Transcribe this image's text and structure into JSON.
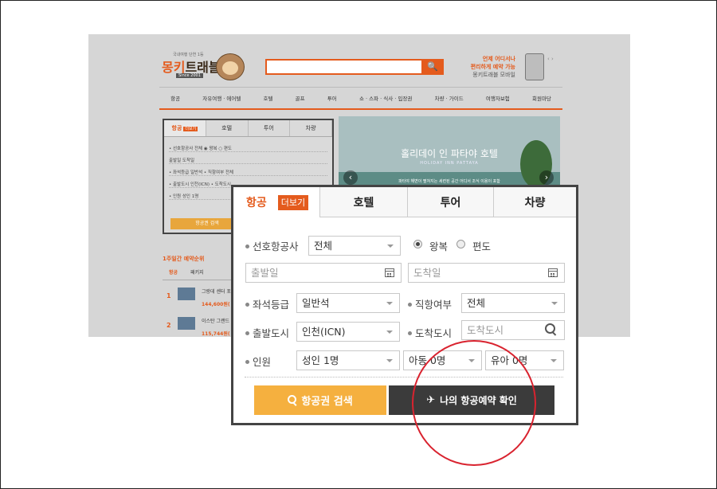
{
  "site": {
    "logo": {
      "tagline": "국내여행 단연 1등",
      "brand_a": "몽키",
      "brand_b": "트래블",
      "since": "Since 2001"
    },
    "promo": {
      "line1": "언제 어디서나",
      "line2": "편리하게 예약 가능",
      "line3": "몽키트래블 모바일"
    },
    "arrows": "‹ ›",
    "search_icon": "🔍",
    "nav": [
      "항공",
      "자유여행 · 에어텔",
      "호텔",
      "골프",
      "투어",
      "쇼 · 스파 · 식사 · 입장권",
      "차량 · 가이드",
      "여행자보험",
      "회원마당"
    ],
    "mini": {
      "tabs": [
        "항공",
        "호텔",
        "투어",
        "차량"
      ],
      "more": "더보기",
      "rows": [
        "• 선호항공사  전체      ◉ 왕복  ○ 편도",
        "출발일            도착일",
        "• 좌석등급  일반석   • 직항여부  전체",
        "• 출발도시  인천(ICN)  • 도착도시",
        "• 인원  성인 1명"
      ],
      "button": "항공권 검색"
    },
    "banner": {
      "title": "홀리데이 인 파타야 호텔",
      "sub": "HOLIDAY INN PATTAYA",
      "cap": "파타야 해변이 펼쳐지는 세련된 공간 어디서 조식 이용이 포함"
    },
    "ranking": {
      "title": "1주일간 예약순위",
      "tabs": [
        "항공",
        "패키지"
      ],
      "items": [
        {
          "num": "1",
          "name": "그랑데 센터 포인트 21(마ㅊ)",
          "price": "144,600원("
        },
        {
          "num": "2",
          "name": "이스탄 그랜드 호텔",
          "price": "115,744원("
        }
      ]
    }
  },
  "widget": {
    "tabs": {
      "air": "항공",
      "more": "더보기",
      "hotel": "호텔",
      "tour": "투어",
      "car": "차량"
    },
    "airline": {
      "label": "선호항공사",
      "value": "전체"
    },
    "trip": {
      "round": "왕복",
      "oneway": "편도",
      "selected": "왕복"
    },
    "depart_date": {
      "placeholder": "출발일"
    },
    "arrive_date": {
      "placeholder": "도착일"
    },
    "seat": {
      "label": "좌석등급",
      "value": "일반석"
    },
    "direct": {
      "label": "직항여부",
      "value": "전체"
    },
    "from": {
      "label": "출발도시",
      "value": "인천(ICN)"
    },
    "to": {
      "label": "도착도시",
      "placeholder": "도착도시"
    },
    "people": {
      "label": "인원",
      "adult": "성인 1명",
      "child": "아동 0명",
      "infant": "유아 0명"
    },
    "buttons": {
      "search": "항공권 검색",
      "mine": "나의 항공예약 확인"
    },
    "plane_icon": "✈"
  },
  "colors": {
    "accent": "#e45b1d",
    "search_button": "#f5b03f",
    "dark_button": "#3b3b3b",
    "highlight": "#d9232f"
  }
}
